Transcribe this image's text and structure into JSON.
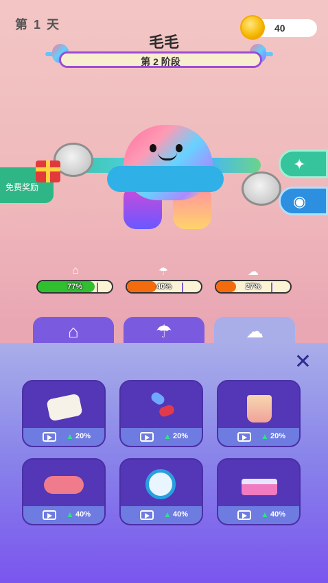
{
  "header": {
    "day_label": "第 1 天",
    "coins": "40",
    "pet_name": "毛毛",
    "stage_label": "第 2 阶段"
  },
  "left_panel": {
    "free_reward_label": "免费奖励"
  },
  "stats": [
    {
      "name": "food",
      "icon": "food-cloche-icon",
      "percent": "77%",
      "value": 77,
      "color": "#2fbf2f"
    },
    {
      "name": "clean",
      "icon": "shower-icon",
      "percent": "40%",
      "value": 40,
      "color": "#f36b0c"
    },
    {
      "name": "sleep",
      "icon": "sleep-cloud-icon",
      "percent": "27%",
      "value": 27,
      "color": "#f36b0c"
    }
  ],
  "tabs": [
    {
      "name": "tab-food",
      "icon": "food-cloche-icon",
      "active": false,
      "color": "#7a5be0"
    },
    {
      "name": "tab-shower",
      "icon": "shower-icon",
      "active": false,
      "color": "#7a5be0"
    },
    {
      "name": "tab-sleep",
      "icon": "sleep-cloud-icon",
      "active": true,
      "color": "#a9aee9"
    }
  ],
  "items": [
    {
      "name": "pillow",
      "boost": "20%"
    },
    {
      "name": "pills",
      "boost": "20%"
    },
    {
      "name": "cup",
      "boost": "20%"
    },
    {
      "name": "eye-mask",
      "boost": "40%"
    },
    {
      "name": "alarm-clock",
      "boost": "40%"
    },
    {
      "name": "bed",
      "boost": "40%"
    }
  ]
}
